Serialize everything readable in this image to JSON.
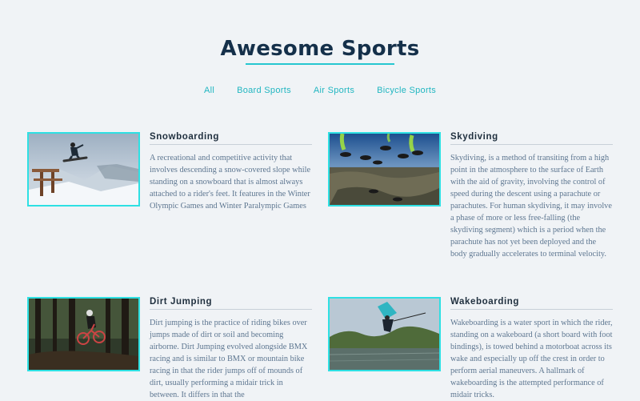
{
  "page": {
    "title": "Awesome Sports"
  },
  "filters": [
    {
      "label": "All"
    },
    {
      "label": "Board Sports"
    },
    {
      "label": "Air Sports"
    },
    {
      "label": "Bicycle Sports"
    }
  ],
  "cards": [
    {
      "title": "Snowboarding",
      "description": "A recreational and competitive activity that involves descending a snow-covered slope while standing on a snowboard that is almost always attached to a rider's feet. It features in the Winter Olympic Games and Winter Paralympic Games"
    },
    {
      "title": "Skydiving",
      "description": "Skydiving, is a method of transiting from a high point in the atmosphere to the surface of Earth with the aid of gravity, involving the control of speed during the descent using a parachute or parachutes. For human skydiving, it may involve a phase of more or less free-falling (the skydiving segment) which is a period when the parachute has not yet been deployed and the body gradually accelerates to terminal velocity."
    },
    {
      "title": "Dirt Jumping",
      "description": "Dirt jumping is the practice of riding bikes over jumps made of dirt or soil and becoming airborne. Dirt Jumping evolved alongside BMX racing and is similar to BMX or mountain bike racing in that the rider jumps off of mounds of dirt, usually performing a midair trick in between. It differs in that the"
    },
    {
      "title": "Wakeboarding",
      "description": "Wakeboarding is a water sport in which the rider, standing on a wakeboard (a short board with foot bindings), is towed behind a motorboat across its wake and especially up off the crest in order to perform aerial maneuvers. A hallmark of wakeboarding is the attempted performance of midair tricks."
    }
  ],
  "colors": {
    "accent": "#26c6d0",
    "title": "#15304a",
    "background": "#f0f3f6",
    "text": "#5d7690"
  }
}
